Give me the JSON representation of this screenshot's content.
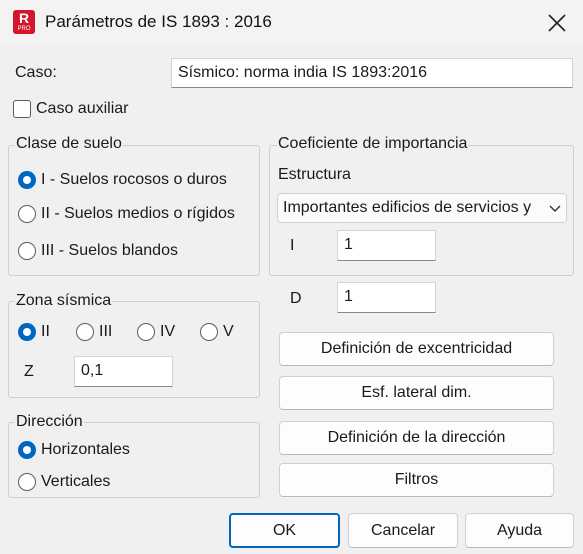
{
  "window": {
    "title": "Parámetros de IS 1893 : 2016",
    "app_icon_letter": "R",
    "app_icon_badge": "PRO"
  },
  "caso": {
    "label": "Caso:",
    "value": "Sísmico: norma india IS 1893:2016"
  },
  "caso_auxiliar": {
    "label": "Caso auxiliar",
    "checked": false
  },
  "clase_suelo": {
    "legend": "Clase de suelo",
    "options": [
      {
        "label": "I - Suelos rocosos o duros",
        "selected": true
      },
      {
        "label": "II - Suelos medios o rígidos",
        "selected": false
      },
      {
        "label": "III - Suelos blandos",
        "selected": false
      }
    ]
  },
  "zona": {
    "legend": "Zona sísmica",
    "options": [
      {
        "label": "II",
        "selected": true
      },
      {
        "label": "III",
        "selected": false
      },
      {
        "label": "IV",
        "selected": false
      },
      {
        "label": "V",
        "selected": false
      }
    ],
    "z_label": "Z",
    "z_value": "0,1"
  },
  "direccion": {
    "legend": "Dirección",
    "options": [
      {
        "label": "Horizontales",
        "selected": true
      },
      {
        "label": "Verticales",
        "selected": false
      }
    ]
  },
  "importancia": {
    "legend": "Coeficiente de importancia",
    "estructura_label": "Estructura",
    "estructura_value": "Importantes edificios de servicios y",
    "i_label": "I",
    "i_value": "1"
  },
  "d": {
    "label": "D",
    "value": "1"
  },
  "buttons": {
    "excentricidad": "Definición de excentricidad",
    "esf_lateral": "Esf. lateral dim.",
    "direccion": "Definición de la dirección",
    "filtros": "Filtros",
    "ok": "OK",
    "cancelar": "Cancelar",
    "ayuda": "Ayuda"
  },
  "colors": {
    "accent": "#0067c0",
    "icon_red": "#d6152a"
  }
}
